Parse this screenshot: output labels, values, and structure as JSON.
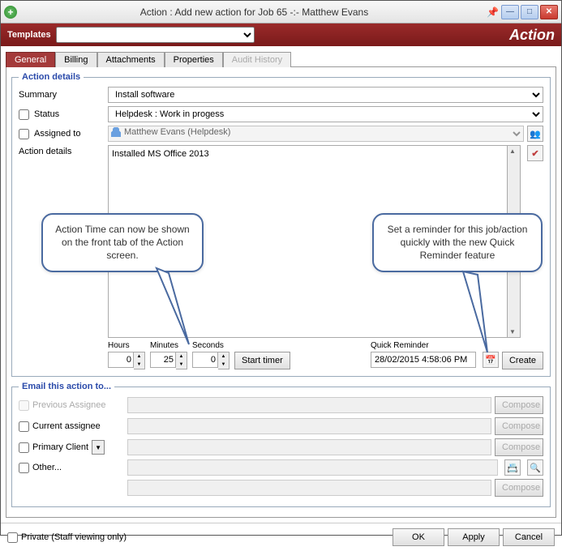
{
  "window": {
    "title": "Action : Add new action for Job 65 -:- Matthew Evans",
    "brand": "Action"
  },
  "templates": {
    "label": "Templates",
    "value": ""
  },
  "tabs": {
    "general": "General",
    "billing": "Billing",
    "attachments": "Attachments",
    "properties": "Properties",
    "audit": "Audit History"
  },
  "details": {
    "legend": "Action details",
    "summary_label": "Summary",
    "summary_value": "Install software",
    "status_label": "Status",
    "status_value": "Helpdesk : Work in progess",
    "assigned_label": "Assigned to",
    "assigned_value": "Matthew Evans (Helpdesk)",
    "details_label": "Action details",
    "details_value": "Installed MS Office 2013"
  },
  "timer": {
    "hours_label": "Hours",
    "hours": "0",
    "minutes_label": "Minutes",
    "minutes": "25",
    "seconds_label": "Seconds",
    "seconds": "0",
    "start": "Start timer",
    "qr_label": "Quick Reminder",
    "qr_value": "28/02/2015 4:58:06 PM",
    "create": "Create"
  },
  "email": {
    "legend": "Email this action to...",
    "prev": "Previous Assignee",
    "curr": "Current assignee",
    "primary": "Primary Client",
    "other": "Other...",
    "compose": "Compose"
  },
  "footer": {
    "private": "Private (Staff viewing only)",
    "ok": "OK",
    "apply": "Apply",
    "cancel": "Cancel"
  },
  "callouts": {
    "c1": "Action Time can now be shown on the front tab of the Action screen.",
    "c2": "Set a reminder for this job/action quickly with the new Quick Reminder feature"
  }
}
